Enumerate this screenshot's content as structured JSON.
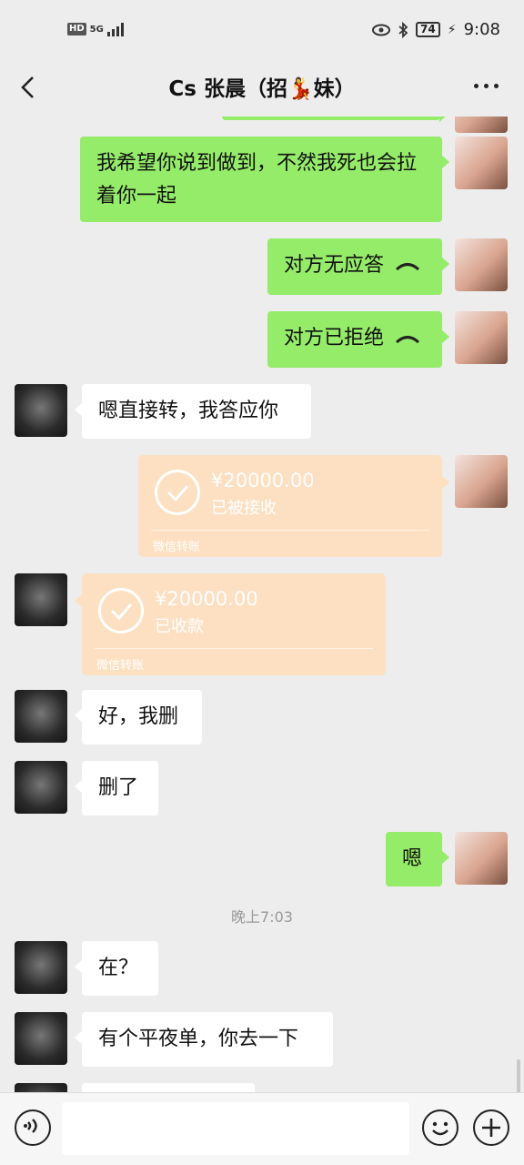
{
  "status_bar": {
    "network_badge": "HD",
    "network_type": "5G",
    "battery": "74",
    "time": "9:08"
  },
  "header": {
    "title": "Cs 张晨（招💃妹）"
  },
  "messages": {
    "m1": "我希望你说到做到，不然我死也会拉着你一起",
    "m2": "对方无应答",
    "m3": "对方已拒绝",
    "m4": "嗯直接转，我答应你",
    "t1": {
      "amount": "¥20000.00",
      "status": "已被接收",
      "footer": "微信转账"
    },
    "t2": {
      "amount": "¥20000.00",
      "status": "已收款",
      "footer": "微信转账"
    },
    "m5": "好，我删",
    "m6": "删了",
    "m7": "嗯",
    "timestamp": "晚上7:03",
    "m8": "在？",
    "m9": "有个平夜单，你去一下"
  },
  "colors": {
    "self_bubble": "#95ec69",
    "other_bubble": "#ffffff",
    "transfer": "#fce0c1",
    "background": "#ededed"
  },
  "icons": [
    "back-icon",
    "more-icon",
    "voice-icon",
    "emoji-icon",
    "plus-icon",
    "hangup-icon",
    "check-circle-icon"
  ]
}
